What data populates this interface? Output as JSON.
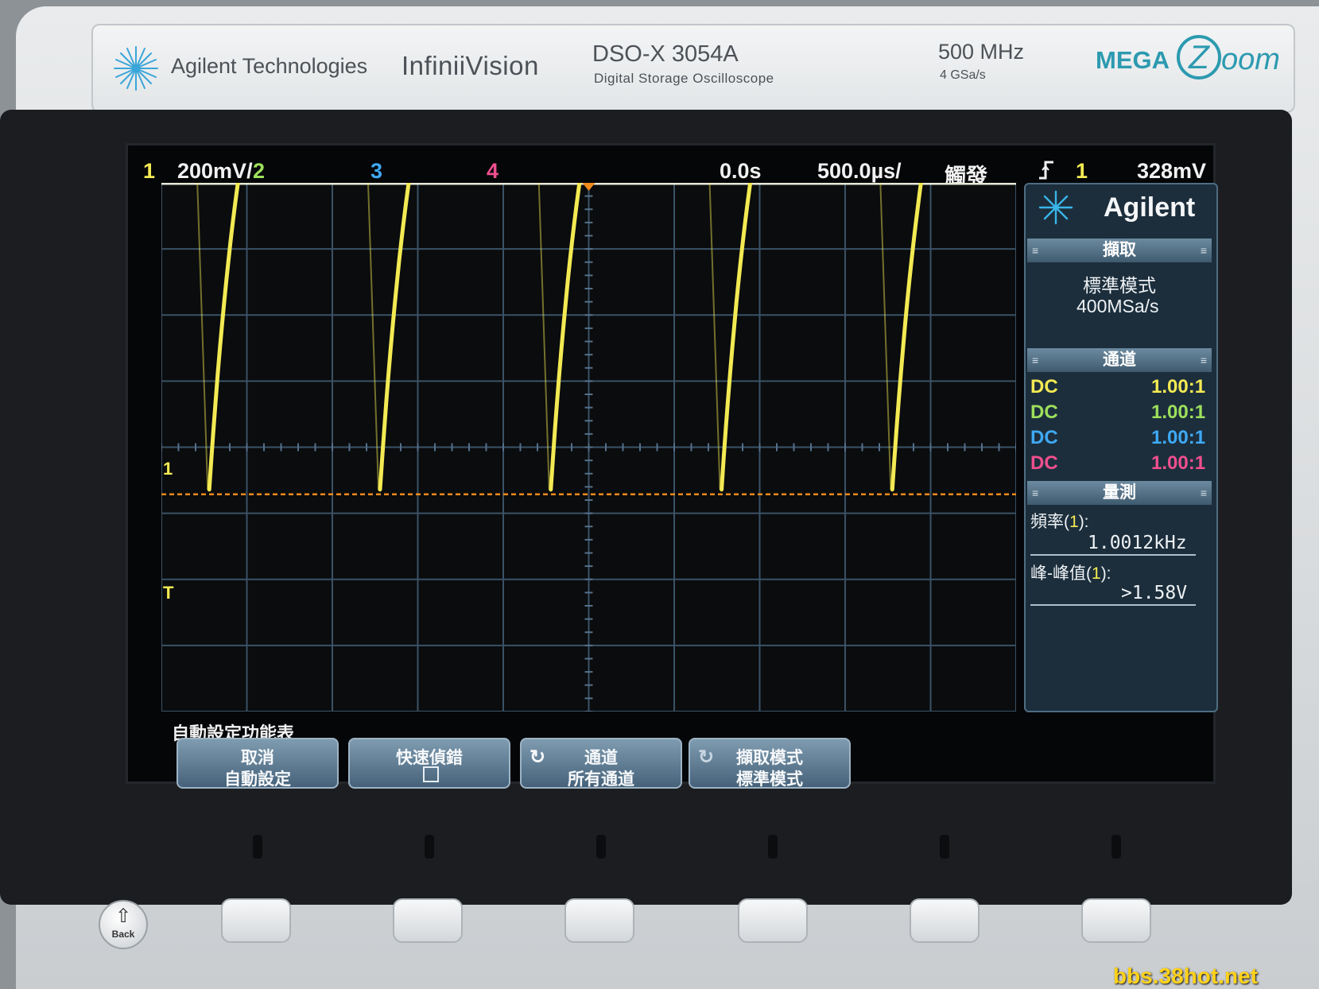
{
  "header": {
    "brand": "Agilent Technologies",
    "series": "InfiniiVision",
    "model": "DSO-X 3054A",
    "model_subtitle": "Digital Storage Oscilloscope",
    "bandwidth": "500 MHz",
    "sample_rate_spec": "4 GSa/s",
    "logo_mega": "MEGA",
    "logo_z": "Z",
    "logo_zoom": "oom"
  },
  "status_bar": {
    "ch1_num": "1",
    "ch1_scale": "200mV/",
    "ch2_num": "2",
    "ch3_num": "3",
    "ch4_num": "4",
    "time_offset": "0.0s",
    "time_scale": "500.0µs/",
    "trigger_mode": "觸發",
    "trigger_edge_icon": "rising-edge-icon",
    "trigger_source": "1",
    "trigger_level": "328mV"
  },
  "markers": {
    "ch1": "1",
    "trigger": "T"
  },
  "side_panel": {
    "brand": "Agilent",
    "acquisition": {
      "header": "擷取",
      "mode": "標準模式",
      "rate": "400MSa/s"
    },
    "channels": {
      "header": "通道",
      "rows": [
        {
          "coupling": "DC",
          "probe": "1.00:1",
          "color": "#f3ea53"
        },
        {
          "coupling": "DC",
          "probe": "1.00:1",
          "color": "#9de05c"
        },
        {
          "coupling": "DC",
          "probe": "1.00:1",
          "color": "#3fa9f5"
        },
        {
          "coupling": "DC",
          "probe": "1.00:1",
          "color": "#ef4f8e"
        }
      ]
    },
    "measure": {
      "header": "量測",
      "freq_label_prefix": "頻率(",
      "freq_label_ch": "1",
      "freq_label_suffix": "):",
      "freq_value": "1.0012kHz",
      "pp_label_prefix": "峰-峰值(",
      "pp_label_ch": "1",
      "pp_label_suffix": "):",
      "pp_value": ">1.58V"
    }
  },
  "softkey_menu": {
    "title": "自動設定功能表",
    "keys": [
      {
        "line1": "取消",
        "line2": "自動設定"
      },
      {
        "line1": "快速偵錯",
        "line2": ""
      },
      {
        "line1": "通道",
        "line2": "所有通道"
      },
      {
        "line1": "擷取模式",
        "line2": "標準模式"
      }
    ]
  },
  "back_button": {
    "label": "Back"
  },
  "watermark": "bbs.38hot.net",
  "chart_data": {
    "type": "line",
    "x_unit": "s",
    "y_unit": "V",
    "time_per_div": 0.0005,
    "volts_per_div": 0.2,
    "x_divisions": 10,
    "y_divisions": 8,
    "frequency_hz": 1001.2,
    "series": [
      {
        "name": "1",
        "color": "#f3ea53",
        "waveform": "rising exponential sawtooth with vertical reset",
        "period_s": 0.000999,
        "low_v": -0.14,
        "high_v": 1.44,
        "first_rise_start_s": -0.00222
      }
    ],
    "trigger_level_v": 0.328,
    "grid": true
  },
  "colors": {
    "ch1": "#f3ea53",
    "ch2": "#9de05c",
    "ch3": "#3fa9f5",
    "ch4": "#ef4f8e",
    "panel_header": "#4f6d82",
    "trigger_line": "#f08a1c"
  }
}
